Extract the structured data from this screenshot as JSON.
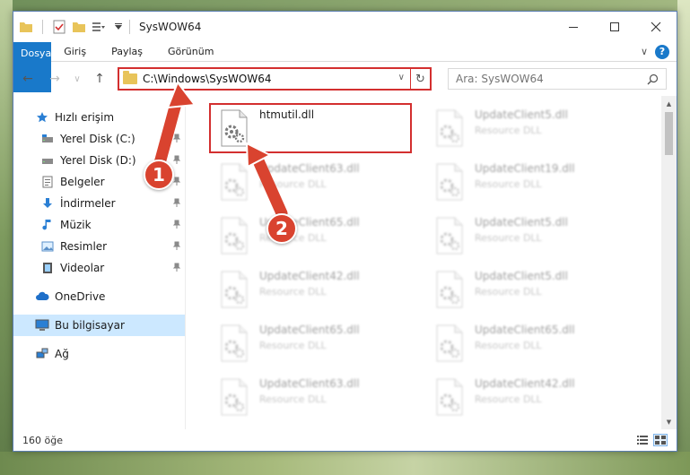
{
  "window": {
    "title": "SysWOW64",
    "controls": {
      "minimize": "—",
      "maximize": "☐",
      "close": "✕"
    }
  },
  "ribbon": {
    "tabs": [
      {
        "label": "Dosya",
        "active": true
      },
      {
        "label": "Giriş"
      },
      {
        "label": "Paylaş"
      },
      {
        "label": "Görünüm"
      }
    ],
    "expand_glyph": "∨",
    "help_glyph": "?"
  },
  "navigation": {
    "back": "←",
    "forward": "→",
    "recent": "∨",
    "up": "↑"
  },
  "address": {
    "path": "C:\\Windows\\SysWOW64",
    "dropdown": "∨",
    "refresh": "↻"
  },
  "search": {
    "placeholder": "Ara: SysWOW64"
  },
  "sidebar": {
    "items": [
      {
        "label": "Hızlı erişim",
        "icon": "star-icon"
      },
      {
        "label": "Yerel Disk (C:)",
        "icon": "drive-icon",
        "pinned": true
      },
      {
        "label": "Yerel Disk (D:)",
        "icon": "drive-icon",
        "pinned": true
      },
      {
        "label": "Belgeler",
        "icon": "documents-icon",
        "pinned": true
      },
      {
        "label": "İndirmeler",
        "icon": "download-icon",
        "pinned": true
      },
      {
        "label": "Müzik",
        "icon": "music-icon",
        "pinned": true
      },
      {
        "label": "Resimler",
        "icon": "pictures-icon",
        "pinned": true
      },
      {
        "label": "Videolar",
        "icon": "videos-icon",
        "pinned": true
      },
      {
        "label": "OneDrive",
        "icon": "cloud-icon"
      },
      {
        "label": "Bu bilgisayar",
        "icon": "computer-icon",
        "selected": true
      },
      {
        "label": "Ağ",
        "icon": "network-icon"
      }
    ]
  },
  "files": [
    {
      "name": "htmutil.dll",
      "type": "",
      "highlighted": true
    },
    {
      "name": "UpdateClient5.dll",
      "type": "Resource DLL"
    },
    {
      "name": "UpdateClient63.dll",
      "type": "Resource DLL"
    },
    {
      "name": "UpdateClient19.dll",
      "type": "Resource DLL"
    },
    {
      "name": "UpdateClient65.dll",
      "type": "Resource DLL"
    },
    {
      "name": "UpdateClient5.dll",
      "type": "Resource DLL"
    },
    {
      "name": "UpdateClient42.dll",
      "type": "Resource DLL"
    },
    {
      "name": "UpdateClient5.dll",
      "type": "Resource DLL"
    },
    {
      "name": "UpdateClient65.dll",
      "type": "Resource DLL"
    },
    {
      "name": "UpdateClient65.dll",
      "type": "Resource DLL"
    },
    {
      "name": "UpdateClient63.dll",
      "type": "Resource DLL"
    },
    {
      "name": "UpdateClient42.dll",
      "type": "Resource DLL"
    }
  ],
  "status": {
    "count": "160 öğe"
  },
  "annotations": {
    "step1": "1",
    "step2": "2",
    "color": "#d9432f"
  }
}
